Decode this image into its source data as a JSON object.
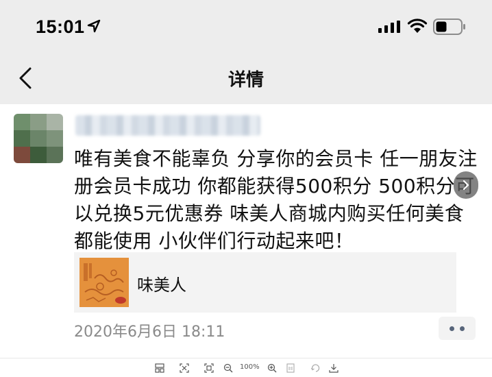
{
  "status_bar": {
    "time": "15:01",
    "icons": [
      "location-arrow-icon",
      "cellular-signal-icon",
      "wifi-icon",
      "battery-icon"
    ]
  },
  "nav": {
    "title": "详情",
    "back_icon": "chevron-left-icon"
  },
  "post": {
    "text": "唯有美食不能辜负 分享你的会员卡 任一朋友注册会员卡成功 你都能获得500积分 500积分可以兑换5元优惠券 味美人商城内购买任何美食都能使用 小伙伴们行动起来吧！",
    "link_card": {
      "title": "味美人"
    },
    "timestamp": "2020年6月6日 18:11",
    "more_icon": "more-dots-icon"
  },
  "toolbar": {
    "zoom_label": "100%",
    "icons": [
      "layout-icon",
      "screenshot-icon",
      "fit-icon",
      "zoom-out-icon",
      "zoom-in-icon",
      "actual-size-icon",
      "rotate-icon",
      "download-icon"
    ]
  },
  "colors": {
    "header_bg": "#ededed",
    "card_bg": "#f3f3f3",
    "timestamp": "#8a8a8a",
    "thumb_orange": "#e5913c"
  }
}
